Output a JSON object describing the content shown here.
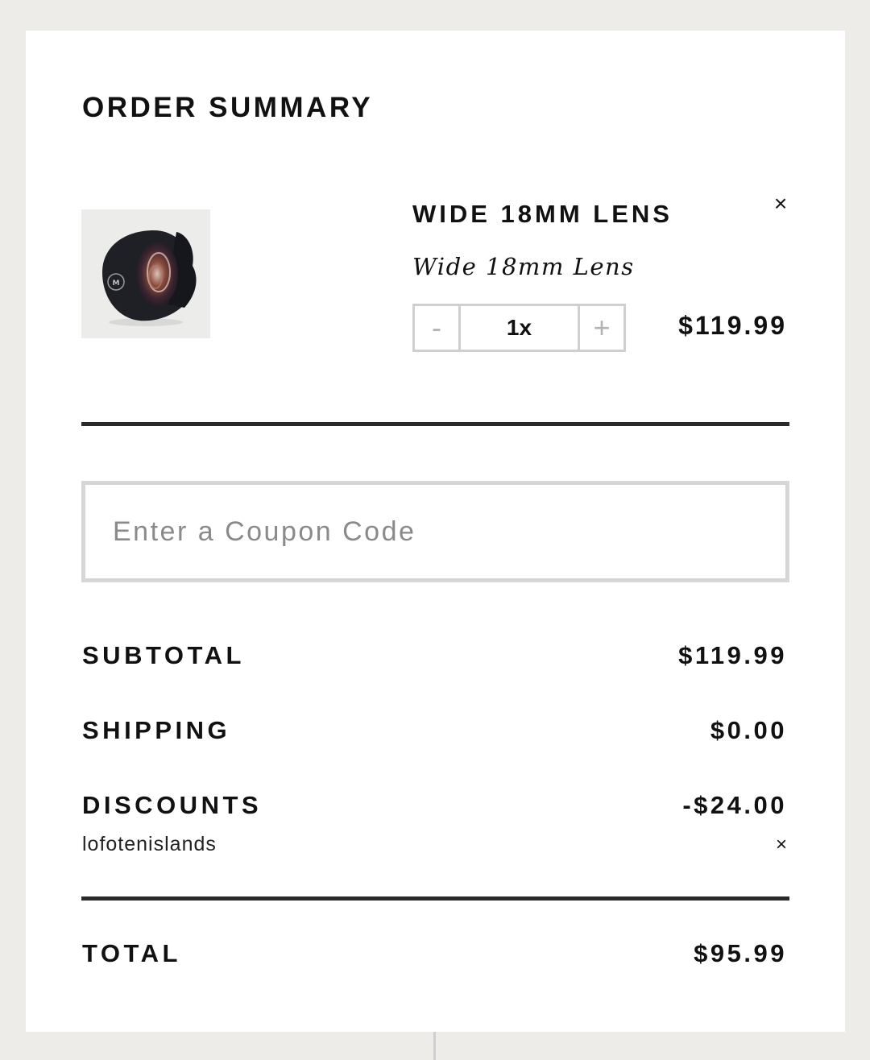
{
  "order_summary": {
    "heading": "ORDER SUMMARY",
    "item": {
      "name": "WIDE 18MM LENS",
      "variant": "Wide 18mm Lens",
      "quantity_display": "1x",
      "decrement_label": "-",
      "increment_label": "+",
      "price": "$119.99",
      "remove_label": "×",
      "image_icon": "camera-lens-icon"
    },
    "coupon": {
      "placeholder": "Enter a Coupon Code",
      "value": ""
    },
    "subtotal": {
      "label": "SUBTOTAL",
      "value": "$119.99"
    },
    "shipping": {
      "label": "SHIPPING",
      "value": "$0.00"
    },
    "discounts": {
      "label": "DISCOUNTS",
      "value": "-$24.00",
      "code": "lofotenislands",
      "remove_label": "×"
    },
    "total": {
      "label": "TOTAL",
      "value": "$95.99"
    }
  }
}
